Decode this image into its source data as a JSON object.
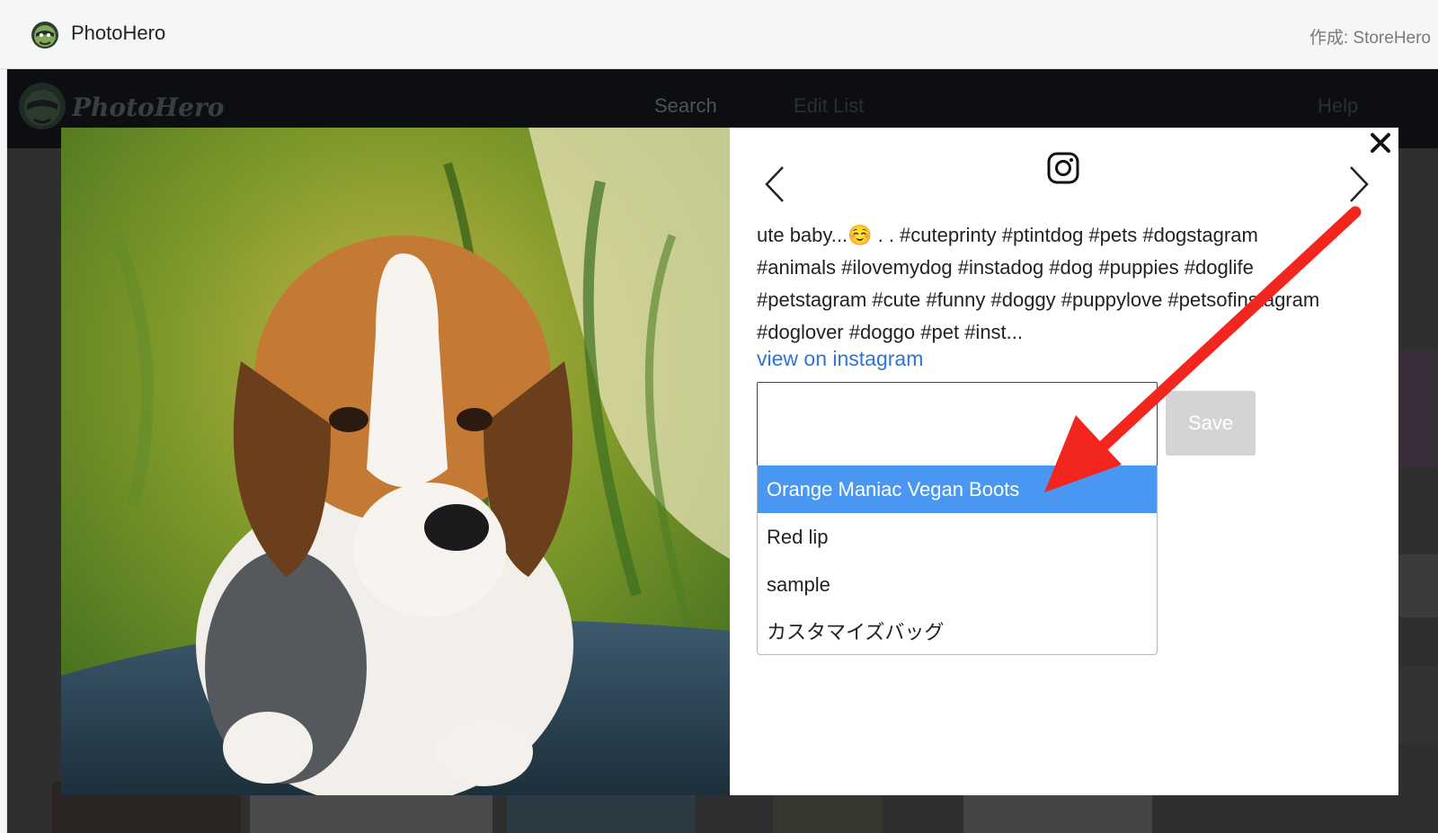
{
  "app_bar": {
    "title": "PhotoHero",
    "author": "作成: StoreHero",
    "logo_icon": "photohero-logo-icon"
  },
  "page": {
    "brand": "PhotoHero",
    "nav": {
      "search": "Search",
      "edit_list": "Edit List",
      "help": "Help"
    }
  },
  "modal": {
    "photo_icon": "beagle-puppy-photo",
    "instagram_icon": "instagram-icon",
    "caption": "ute baby...☺️  . . #cuteprinty #ptintdog #pets #dogstagram #animals #ilovemydog #instadog #dog #puppies #doglife #petstagram #cute #funny #doggy #puppylove #petsofinstagram #doglover #doggo #pet #inst...",
    "view_link": "view on instagram",
    "input": {
      "value": "",
      "placeholder": ""
    },
    "save_label": "Save",
    "dropdown": {
      "selected_index": 0,
      "options": [
        "Orange Maniac Vegan Boots",
        "Red lip",
        "sample",
        "カスタマイズバッグ"
      ]
    }
  },
  "colors": {
    "highlight": "#4a97f3",
    "link": "#2f74d6",
    "save_disabled": "#d4d4d4",
    "arrow": "#f2261f"
  }
}
